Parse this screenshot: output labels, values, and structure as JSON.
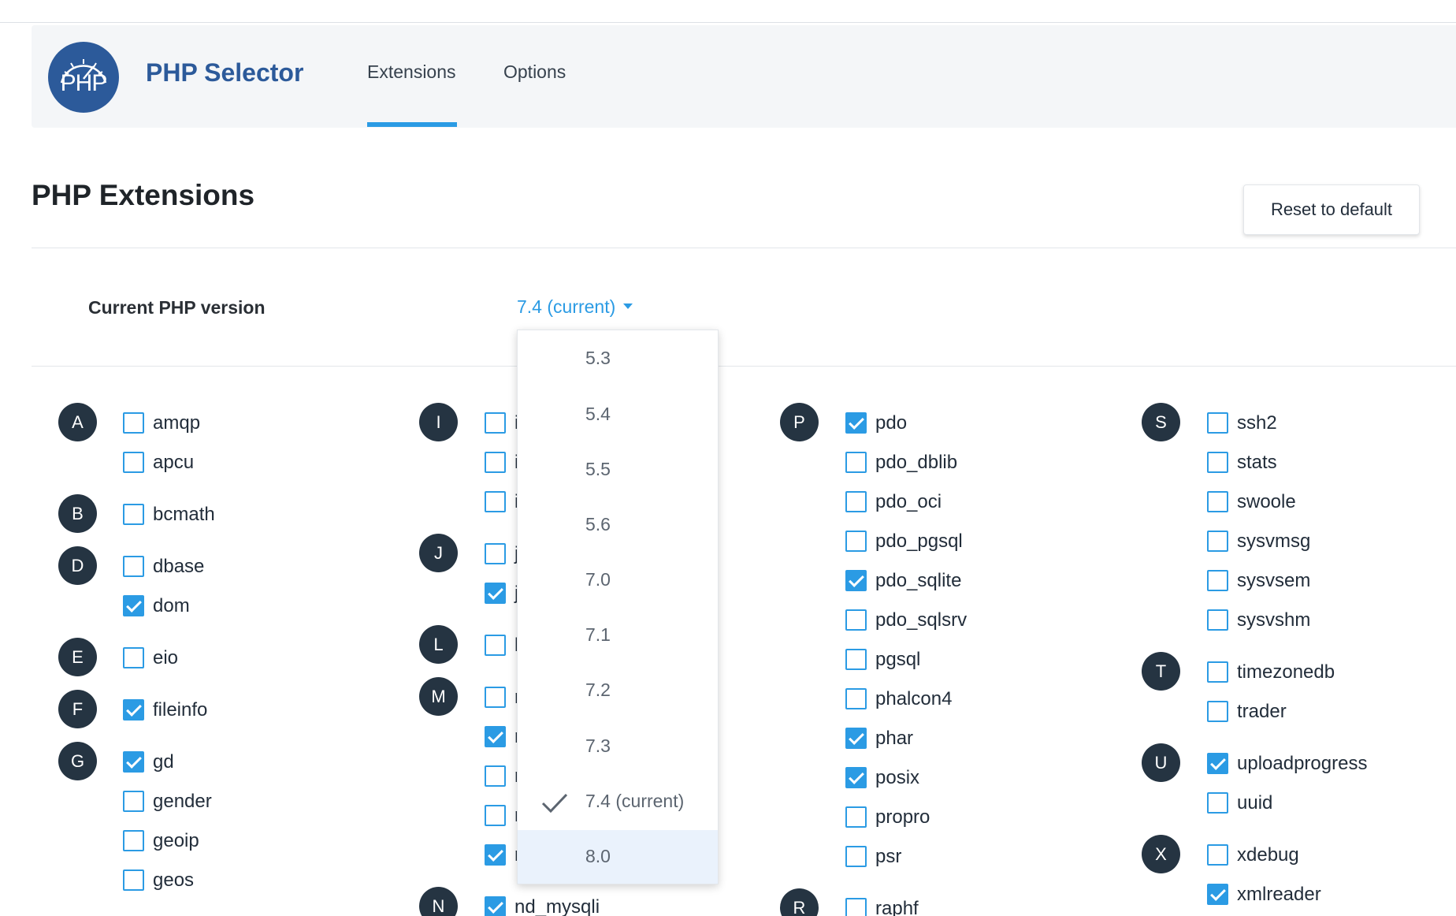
{
  "header": {
    "logo_text": "PHP",
    "app_title": "PHP Selector",
    "tabs": [
      {
        "label": "Extensions",
        "active": true
      },
      {
        "label": "Options",
        "active": false
      }
    ]
  },
  "page": {
    "title": "PHP Extensions",
    "reset_button": "Reset to default"
  },
  "version": {
    "label": "Current PHP version",
    "selected": "7.4 (current)",
    "options": [
      "5.3",
      "5.4",
      "5.5",
      "5.6",
      "7.0",
      "7.1",
      "7.2",
      "7.3",
      "7.4 (current)",
      "8.0"
    ],
    "checked_option": "7.4 (current)",
    "hovered_option": "8.0"
  },
  "extensions": {
    "col1": [
      {
        "letter": "A",
        "items": [
          {
            "name": "amqp",
            "checked": false
          },
          {
            "name": "apcu",
            "checked": false
          }
        ]
      },
      {
        "letter": "B",
        "items": [
          {
            "name": "bcmath",
            "checked": false
          }
        ]
      },
      {
        "letter": "D",
        "items": [
          {
            "name": "dbase",
            "checked": false
          },
          {
            "name": "dom",
            "checked": true
          }
        ]
      },
      {
        "letter": "E",
        "items": [
          {
            "name": "eio",
            "checked": false
          }
        ]
      },
      {
        "letter": "F",
        "items": [
          {
            "name": "fileinfo",
            "checked": true
          }
        ]
      },
      {
        "letter": "G",
        "items": [
          {
            "name": "gd",
            "checked": true
          },
          {
            "name": "gender",
            "checked": false
          },
          {
            "name": "geoip",
            "checked": false
          },
          {
            "name": "geos",
            "checked": false
          }
        ]
      }
    ],
    "col2": [
      {
        "letter": "I",
        "items": [
          {
            "name": "i",
            "checked": false
          },
          {
            "name": "i",
            "checked": false
          },
          {
            "name": "i",
            "checked": false
          }
        ]
      },
      {
        "letter": "J",
        "items": [
          {
            "name": "j",
            "checked": false
          },
          {
            "name": "j",
            "checked": true
          }
        ]
      },
      {
        "letter": "L",
        "items": [
          {
            "name": "l",
            "checked": false
          }
        ]
      },
      {
        "letter": "M",
        "items": [
          {
            "name": "r",
            "checked": false
          },
          {
            "name": "r",
            "checked": true
          },
          {
            "name": "r",
            "checked": false
          },
          {
            "name": "r",
            "checked": false
          },
          {
            "name": "r",
            "checked": true
          }
        ]
      },
      {
        "letter": "N",
        "items": [
          {
            "name": "nd_mysqli",
            "checked": true
          }
        ]
      }
    ],
    "col3": [
      {
        "letter": "P",
        "items": [
          {
            "name": "pdo",
            "checked": true
          },
          {
            "name": "pdo_dblib",
            "checked": false
          },
          {
            "name": "pdo_oci",
            "checked": false
          },
          {
            "name": "pdo_pgsql",
            "checked": false
          },
          {
            "name": "pdo_sqlite",
            "checked": true
          },
          {
            "name": "pdo_sqlsrv",
            "checked": false
          },
          {
            "name": "pgsql",
            "checked": false
          },
          {
            "name": "phalcon4",
            "checked": false
          },
          {
            "name": "phar",
            "checked": true
          },
          {
            "name": "posix",
            "checked": true
          },
          {
            "name": "propro",
            "checked": false
          },
          {
            "name": "psr",
            "checked": false
          }
        ]
      },
      {
        "letter": "R",
        "items": [
          {
            "name": "raphf",
            "checked": false
          }
        ]
      }
    ],
    "col4": [
      {
        "letter": "S",
        "items": [
          {
            "name": "ssh2",
            "checked": false
          },
          {
            "name": "stats",
            "checked": false
          },
          {
            "name": "swoole",
            "checked": false
          },
          {
            "name": "sysvmsg",
            "checked": false
          },
          {
            "name": "sysvsem",
            "checked": false
          },
          {
            "name": "sysvshm",
            "checked": false
          }
        ]
      },
      {
        "letter": "T",
        "items": [
          {
            "name": "timezonedb",
            "checked": false
          },
          {
            "name": "trader",
            "checked": false
          }
        ]
      },
      {
        "letter": "U",
        "items": [
          {
            "name": "uploadprogress",
            "checked": true
          },
          {
            "name": "uuid",
            "checked": false
          }
        ]
      },
      {
        "letter": "X",
        "items": [
          {
            "name": "xdebug",
            "checked": false
          },
          {
            "name": "xmlreader",
            "checked": true
          }
        ]
      }
    ]
  },
  "colors": {
    "accent": "#2b9be4",
    "brand": "#2c5a9a",
    "badge": "#253442",
    "header_bg": "#f4f6f8"
  }
}
